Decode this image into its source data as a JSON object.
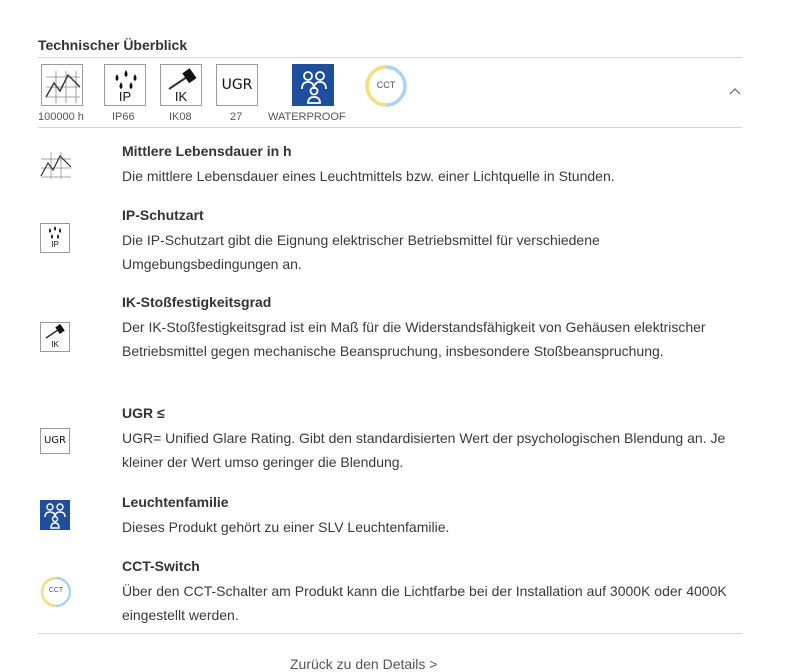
{
  "section": {
    "title": "Technischer Überblick"
  },
  "icon_bar": {
    "icons": [
      {
        "icon": "lifetime-chart-icon",
        "caption": "100000 h"
      },
      {
        "icon": "ip-protection-icon",
        "glyph_text": "IP",
        "caption": "IP66"
      },
      {
        "icon": "ik-impact-hammer-icon",
        "glyph_text": "IK",
        "caption": "IK08"
      },
      {
        "icon": "ugr-icon",
        "glyph_text": "UGR",
        "caption": "27"
      },
      {
        "icon": "family-icon",
        "caption": "WATERPROOF"
      },
      {
        "icon": "cct-switch-icon",
        "glyph_text": "CCT",
        "caption": ""
      }
    ],
    "collapse_icon": "chevron-up-icon"
  },
  "details": [
    {
      "title": "Mittlere Lebensdauer in h",
      "description": "Die mittlere Lebensdauer eines Leuchtmittels bzw. einer Lichtquelle in Stunden."
    },
    {
      "title": "IP-Schutzart",
      "description": "Die IP-Schutzart gibt die Eignung elektrischer Betriebsmittel für verschiedene Umgebungsbedingungen an."
    },
    {
      "title": "IK-Stoßfestigkeitsgrad",
      "description": "Der IK-Stoßfestigkeitsgrad ist ein Maß für die Widerstandsfähigkeit von Gehäusen elektrischer Betriebsmittel gegen mechanische Beanspruchung, insbesondere Stoßbeanspruchung."
    },
    {
      "title": "UGR ≤",
      "description": "UGR= Unified Glare Rating. Gibt den standardisierten Wert der psychologischen Blendung an. Je kleiner der Wert umso geringer die Blendung."
    },
    {
      "title": "Leuchtenfamilie",
      "description": "Dieses Produkt gehört zu einer SLV Leuchtenfamilie."
    },
    {
      "title": "CCT-Switch",
      "description": "Über den CCT-Schalter am Produkt kann die Lichtfarbe bei der Installation auf 3000K oder 4000K eingestellt werden."
    }
  ],
  "footer": {
    "link_label": "Zurück zu den Details >"
  },
  "colors": {
    "family_blue": "#1f4f9c",
    "cct_ring_yellow": "#f4dc7a",
    "cct_ring_blue": "#a9d3ee",
    "rule": "#d4d4d4"
  }
}
